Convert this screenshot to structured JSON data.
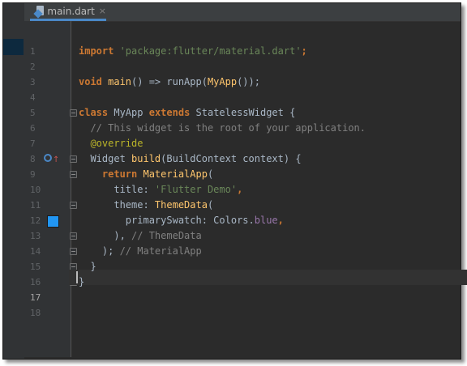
{
  "tab": {
    "label": "main.dart",
    "close": "×"
  },
  "current_line": 17,
  "gutter": {
    "override_line": 8,
    "color_swatch_line": 12,
    "color_swatch_color": "#2196f3",
    "fold_lines": [
      5,
      8,
      9,
      11,
      13,
      14,
      15,
      16
    ]
  },
  "code": {
    "lines": [
      [
        {
          "t": "import ",
          "c": "kw"
        },
        {
          "t": "'package:flutter/material.dart'",
          "c": "str"
        },
        {
          "t": ";",
          "c": "kw"
        }
      ],
      [],
      [
        {
          "t": "void ",
          "c": "kw"
        },
        {
          "t": "main",
          "c": "fn"
        },
        {
          "t": "() => runApp(",
          "c": ""
        },
        {
          "t": "MyApp",
          "c": "fn"
        },
        {
          "t": "());",
          "c": ""
        }
      ],
      [],
      [
        {
          "t": "class ",
          "c": "kw"
        },
        {
          "t": "MyApp ",
          "c": ""
        },
        {
          "t": "extends ",
          "c": "kw"
        },
        {
          "t": "StatelessWidget {",
          "c": ""
        }
      ],
      [
        {
          "t": "  // This widget is the root of your application.",
          "c": "cmt"
        }
      ],
      [
        {
          "t": "  @override",
          "c": "ann"
        }
      ],
      [
        {
          "t": "  Widget ",
          "c": ""
        },
        {
          "t": "build",
          "c": "fn"
        },
        {
          "t": "(BuildContext context) {",
          "c": ""
        }
      ],
      [
        {
          "t": "    ",
          "c": ""
        },
        {
          "t": "return ",
          "c": "kw"
        },
        {
          "t": "MaterialApp",
          "c": "fn"
        },
        {
          "t": "(",
          "c": ""
        }
      ],
      [
        {
          "t": "      title: ",
          "c": ""
        },
        {
          "t": "'Flutter Demo'",
          "c": "str"
        },
        {
          "t": ",",
          "c": "kw"
        }
      ],
      [
        {
          "t": "      theme: ",
          "c": ""
        },
        {
          "t": "ThemeData",
          "c": "fn"
        },
        {
          "t": "(",
          "c": ""
        }
      ],
      [
        {
          "t": "        primarySwatch: Colors.",
          "c": ""
        },
        {
          "t": "blue",
          "c": "prop"
        },
        {
          "t": ",",
          "c": "kw"
        }
      ],
      [
        {
          "t": "      ), ",
          "c": ""
        },
        {
          "t": "// ThemeData",
          "c": "cmt"
        }
      ],
      [
        {
          "t": "    ); ",
          "c": ""
        },
        {
          "t": "// MaterialApp",
          "c": "cmt"
        }
      ],
      [
        {
          "t": "  }",
          "c": ""
        }
      ],
      [
        {
          "t": "}",
          "c": ""
        }
      ],
      [],
      []
    ]
  }
}
